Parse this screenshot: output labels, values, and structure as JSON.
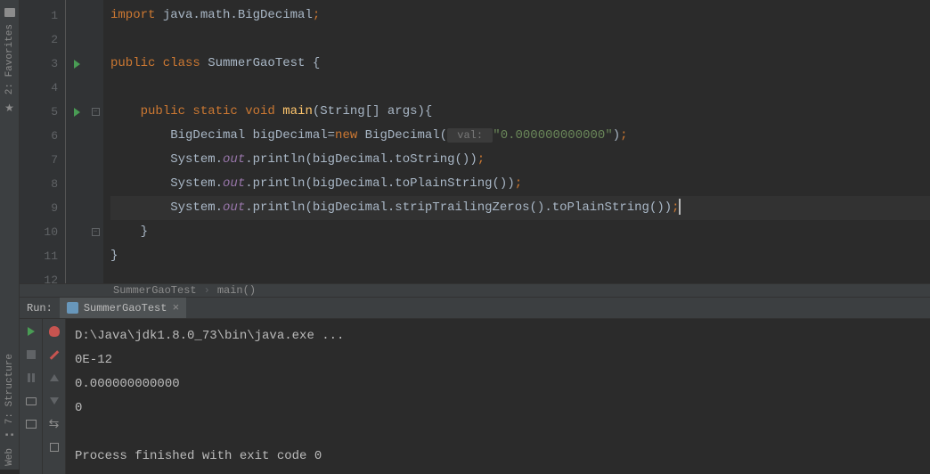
{
  "sidebar": {
    "favorites": "2: Favorites",
    "structure": "7: Structure",
    "web": "Web"
  },
  "code": {
    "lines": [
      {
        "num": "1",
        "tokens": [
          {
            "t": "import ",
            "c": "kw-orange"
          },
          {
            "t": "java.math.BigDecimal",
            "c": "default"
          },
          {
            "t": ";",
            "c": "kw-orange"
          }
        ]
      },
      {
        "num": "2",
        "tokens": []
      },
      {
        "num": "3",
        "tokens": [
          {
            "t": "public class ",
            "c": "kw-orange"
          },
          {
            "t": "SummerGaoTest ",
            "c": "default"
          },
          {
            "t": "{",
            "c": "default"
          }
        ],
        "run": true
      },
      {
        "num": "4",
        "tokens": []
      },
      {
        "num": "5",
        "tokens": [
          {
            "t": "    ",
            "c": "default"
          },
          {
            "t": "public static void ",
            "c": "kw-orange"
          },
          {
            "t": "main",
            "c": "method-yellow"
          },
          {
            "t": "(",
            "c": "default"
          },
          {
            "t": "String",
            "c": "default"
          },
          {
            "t": "[] ",
            "c": "default"
          },
          {
            "t": "args",
            "c": "default"
          },
          {
            "t": ")",
            "c": "default"
          },
          {
            "t": "{",
            "c": "default"
          }
        ],
        "run": true,
        "fold": true
      },
      {
        "num": "6",
        "tokens": [
          {
            "t": "        BigDecimal bigDecimal=",
            "c": "default"
          },
          {
            "t": "new ",
            "c": "kw-orange"
          },
          {
            "t": "BigDecimal",
            "c": "default"
          },
          {
            "t": "(",
            "c": "default"
          },
          {
            "t": " val: ",
            "c": "param-hint"
          },
          {
            "t": "\"0.000000000000\"",
            "c": "string-green"
          },
          {
            "t": ")",
            "c": "default"
          },
          {
            "t": ";",
            "c": "kw-orange"
          }
        ]
      },
      {
        "num": "7",
        "tokens": [
          {
            "t": "        System.",
            "c": "default"
          },
          {
            "t": "out",
            "c": "kw-purple"
          },
          {
            "t": ".println",
            "c": "default"
          },
          {
            "t": "(",
            "c": "default"
          },
          {
            "t": "bigDecimal.toString",
            "c": "default"
          },
          {
            "t": "()",
            "c": "default"
          },
          {
            "t": ")",
            "c": "default"
          },
          {
            "t": ";",
            "c": "kw-orange"
          }
        ]
      },
      {
        "num": "8",
        "tokens": [
          {
            "t": "        System.",
            "c": "default"
          },
          {
            "t": "out",
            "c": "kw-purple"
          },
          {
            "t": ".println",
            "c": "default"
          },
          {
            "t": "(",
            "c": "default"
          },
          {
            "t": "bigDecimal.toPlainString",
            "c": "default"
          },
          {
            "t": "()",
            "c": "default"
          },
          {
            "t": ")",
            "c": "default"
          },
          {
            "t": ";",
            "c": "kw-orange"
          }
        ]
      },
      {
        "num": "9",
        "tokens": [
          {
            "t": "        System.",
            "c": "default"
          },
          {
            "t": "out",
            "c": "kw-purple"
          },
          {
            "t": ".println",
            "c": "default"
          },
          {
            "t": "(",
            "c": "default"
          },
          {
            "t": "bigDecimal.stripTrailingZeros",
            "c": "default"
          },
          {
            "t": "()",
            "c": "default"
          },
          {
            "t": ".toPlainString",
            "c": "default"
          },
          {
            "t": "()",
            "c": "default"
          },
          {
            "t": ")",
            "c": "default"
          },
          {
            "t": ";",
            "c": "kw-orange"
          }
        ],
        "highlighted": true,
        "cursor": true
      },
      {
        "num": "10",
        "tokens": [
          {
            "t": "    }",
            "c": "default"
          }
        ],
        "fold": true
      },
      {
        "num": "11",
        "tokens": [
          {
            "t": "}",
            "c": "default"
          }
        ]
      },
      {
        "num": "12",
        "tokens": []
      }
    ]
  },
  "breadcrumb": {
    "class": "SummerGaoTest",
    "method": "main()"
  },
  "run": {
    "label": "Run:",
    "tab_name": "SummerGaoTest",
    "console": [
      "D:\\Java\\jdk1.8.0_73\\bin\\java.exe ...",
      "0E-12",
      "0.000000000000",
      "0",
      "",
      "Process finished with exit code 0"
    ]
  }
}
